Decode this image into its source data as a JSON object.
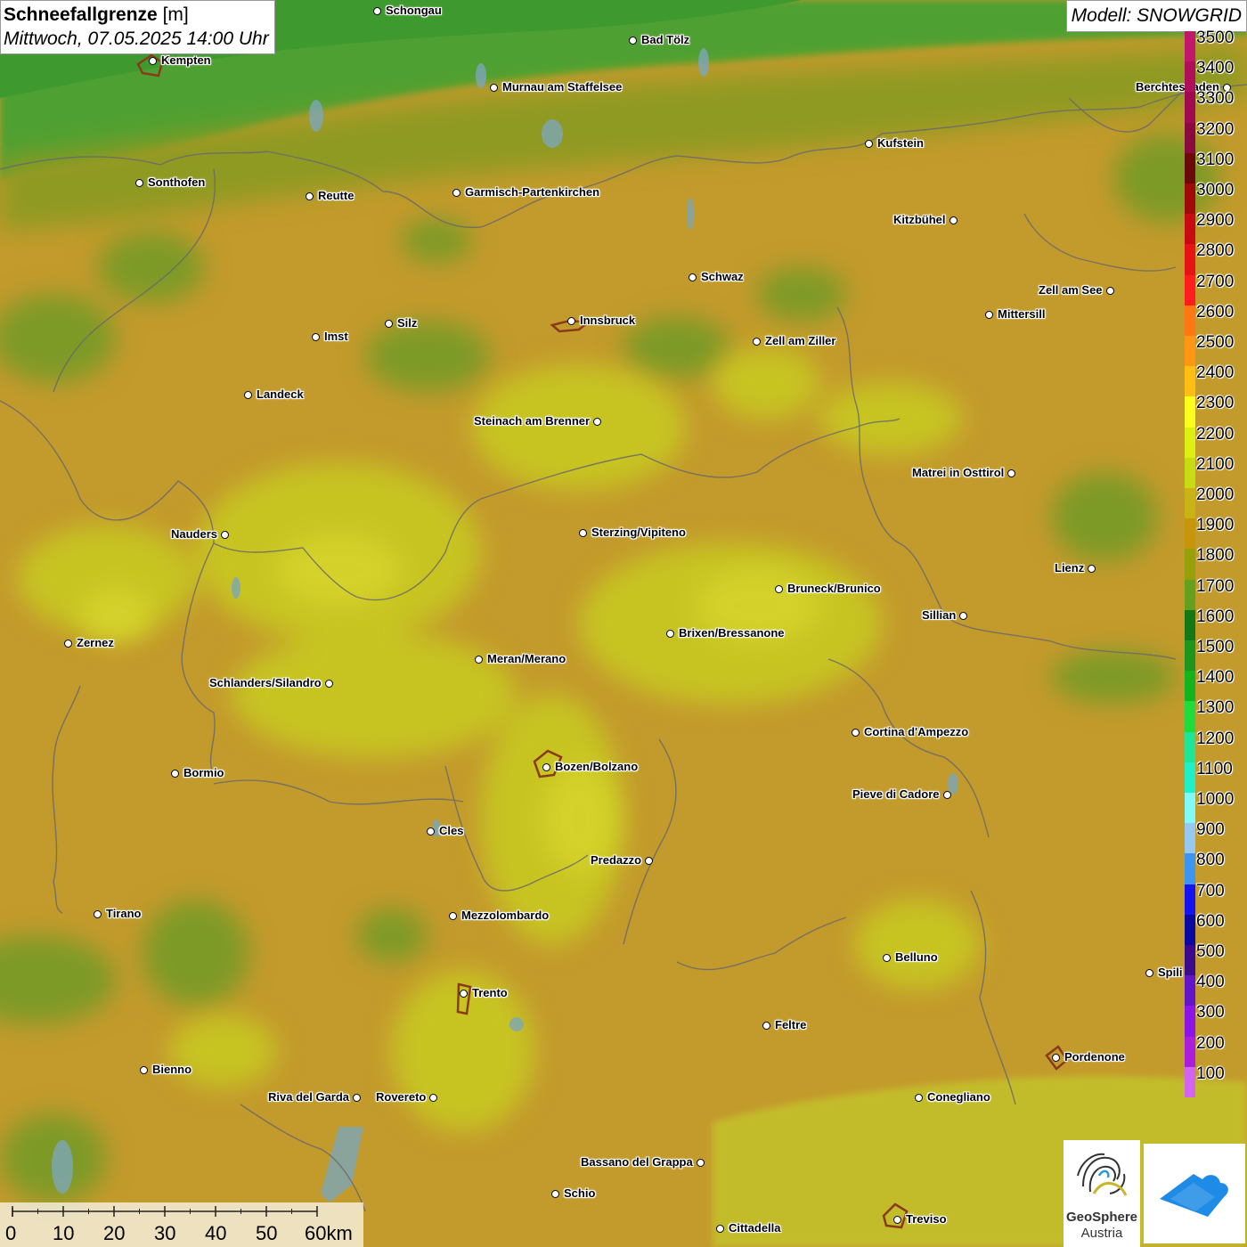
{
  "title": {
    "main": "Schneefallgrenze",
    "unit": "[m]",
    "datetime": "Mittwoch, 07.05.2025 14:00 Uhr"
  },
  "model": "Modell: SNOWGRID",
  "legend": {
    "levels": [
      {
        "label": "3500",
        "color": "#c2186b"
      },
      {
        "label": "3400",
        "color": "#b0105a"
      },
      {
        "label": "3300",
        "color": "#a00a50"
      },
      {
        "label": "3200",
        "color": "#8a0a40"
      },
      {
        "label": "3100",
        "color": "#6b0a0a"
      },
      {
        "label": "3000",
        "color": "#a00a0a"
      },
      {
        "label": "2900",
        "color": "#c80a14"
      },
      {
        "label": "2800",
        "color": "#e61414"
      },
      {
        "label": "2700",
        "color": "#ff1e1e"
      },
      {
        "label": "2600",
        "color": "#ff7814"
      },
      {
        "label": "2500",
        "color": "#ff9614"
      },
      {
        "label": "2400",
        "color": "#ffbe14"
      },
      {
        "label": "2300",
        "color": "#ffff1e"
      },
      {
        "label": "2200",
        "color": "#dcf014"
      },
      {
        "label": "2100",
        "color": "#c8dc14"
      },
      {
        "label": "2000",
        "color": "#c8b414"
      },
      {
        "label": "1900",
        "color": "#c8960a"
      },
      {
        "label": "1800",
        "color": "#96a00a"
      },
      {
        "label": "1700",
        "color": "#64a01e"
      },
      {
        "label": "1600",
        "color": "#147814"
      },
      {
        "label": "1500",
        "color": "#1e961e"
      },
      {
        "label": "1400",
        "color": "#14b41e"
      },
      {
        "label": "1300",
        "color": "#1edc3c"
      },
      {
        "label": "1200",
        "color": "#1ee696"
      },
      {
        "label": "1100",
        "color": "#1ef0c8"
      },
      {
        "label": "1000",
        "color": "#82fafa"
      },
      {
        "label": "900",
        "color": "#96c8f0"
      },
      {
        "label": "800",
        "color": "#3c96f0"
      },
      {
        "label": "700",
        "color": "#1414f0"
      },
      {
        "label": "600",
        "color": "#0a0aa0"
      },
      {
        "label": "500",
        "color": "#3c0a8c"
      },
      {
        "label": "400",
        "color": "#6414c8"
      },
      {
        "label": "300",
        "color": "#8c14e6"
      },
      {
        "label": "200",
        "color": "#aa1edc"
      },
      {
        "label": "100",
        "color": "#d264f0"
      }
    ]
  },
  "cities": [
    {
      "name": "Schongau",
      "side": "right"
    },
    {
      "name": "Bad Tölz",
      "side": "right"
    },
    {
      "name": "Kempten",
      "side": "right"
    },
    {
      "name": "Murnau am Staffelsee",
      "side": "right"
    },
    {
      "name": "Berchtesgaden",
      "side": "left"
    },
    {
      "name": "Kufstein",
      "side": "right"
    },
    {
      "name": "Sonthofen",
      "side": "right"
    },
    {
      "name": "Reutte",
      "side": "right"
    },
    {
      "name": "Garmisch-Partenkirchen",
      "side": "right"
    },
    {
      "name": "Kitzbühel",
      "side": "left"
    },
    {
      "name": "Schwaz",
      "side": "right"
    },
    {
      "name": "Zell am See",
      "side": "left"
    },
    {
      "name": "Innsbruck",
      "side": "right"
    },
    {
      "name": "Mittersill",
      "side": "right"
    },
    {
      "name": "Silz",
      "side": "right"
    },
    {
      "name": "Imst",
      "side": "right"
    },
    {
      "name": "Zell am Ziller",
      "side": "right"
    },
    {
      "name": "Landeck",
      "side": "right"
    },
    {
      "name": "Steinach am Brenner",
      "side": "left"
    },
    {
      "name": "Matrei in Osttirol",
      "side": "left"
    },
    {
      "name": "Nauders",
      "side": "left"
    },
    {
      "name": "Sterzing/Vipiteno",
      "side": "right"
    },
    {
      "name": "Lienz",
      "side": "left"
    },
    {
      "name": "Bruneck/Brunico",
      "side": "right"
    },
    {
      "name": "Sillian",
      "side": "left"
    },
    {
      "name": "Zernez",
      "side": "right"
    },
    {
      "name": "Brixen/Bressanone",
      "side": "right"
    },
    {
      "name": "Meran/Merano",
      "side": "right"
    },
    {
      "name": "Schlanders/Silandro",
      "side": "left"
    },
    {
      "name": "Cortina d'Ampezzo",
      "side": "right"
    },
    {
      "name": "Bormio",
      "side": "right"
    },
    {
      "name": "Bozen/Bolzano",
      "side": "right"
    },
    {
      "name": "Pieve di Cadore",
      "side": "left"
    },
    {
      "name": "Cles",
      "side": "right"
    },
    {
      "name": "Predazzo",
      "side": "left"
    },
    {
      "name": "Tirano",
      "side": "right"
    },
    {
      "name": "Mezzolombardo",
      "side": "right"
    },
    {
      "name": "Belluno",
      "side": "right"
    },
    {
      "name": "Spili",
      "side": "right"
    },
    {
      "name": "Trento",
      "side": "right"
    },
    {
      "name": "Feltre",
      "side": "right"
    },
    {
      "name": "Pordenone",
      "side": "right"
    },
    {
      "name": "Bienno",
      "side": "right"
    },
    {
      "name": "Riva del Garda",
      "side": "left"
    },
    {
      "name": "Rovereto",
      "side": "left"
    },
    {
      "name": "Conegliano",
      "side": "right"
    },
    {
      "name": "Bassano del Grappa",
      "side": "left"
    },
    {
      "name": "Schio",
      "side": "right"
    },
    {
      "name": "Treviso",
      "side": "right"
    },
    {
      "name": "Cittadella",
      "side": "right"
    }
  ],
  "scalebar": {
    "labels": [
      "0",
      "10",
      "20",
      "30",
      "40",
      "50",
      "60km"
    ]
  },
  "logos": {
    "geosphere_line1": "GeoSphere",
    "geosphere_line2": "Austria"
  }
}
